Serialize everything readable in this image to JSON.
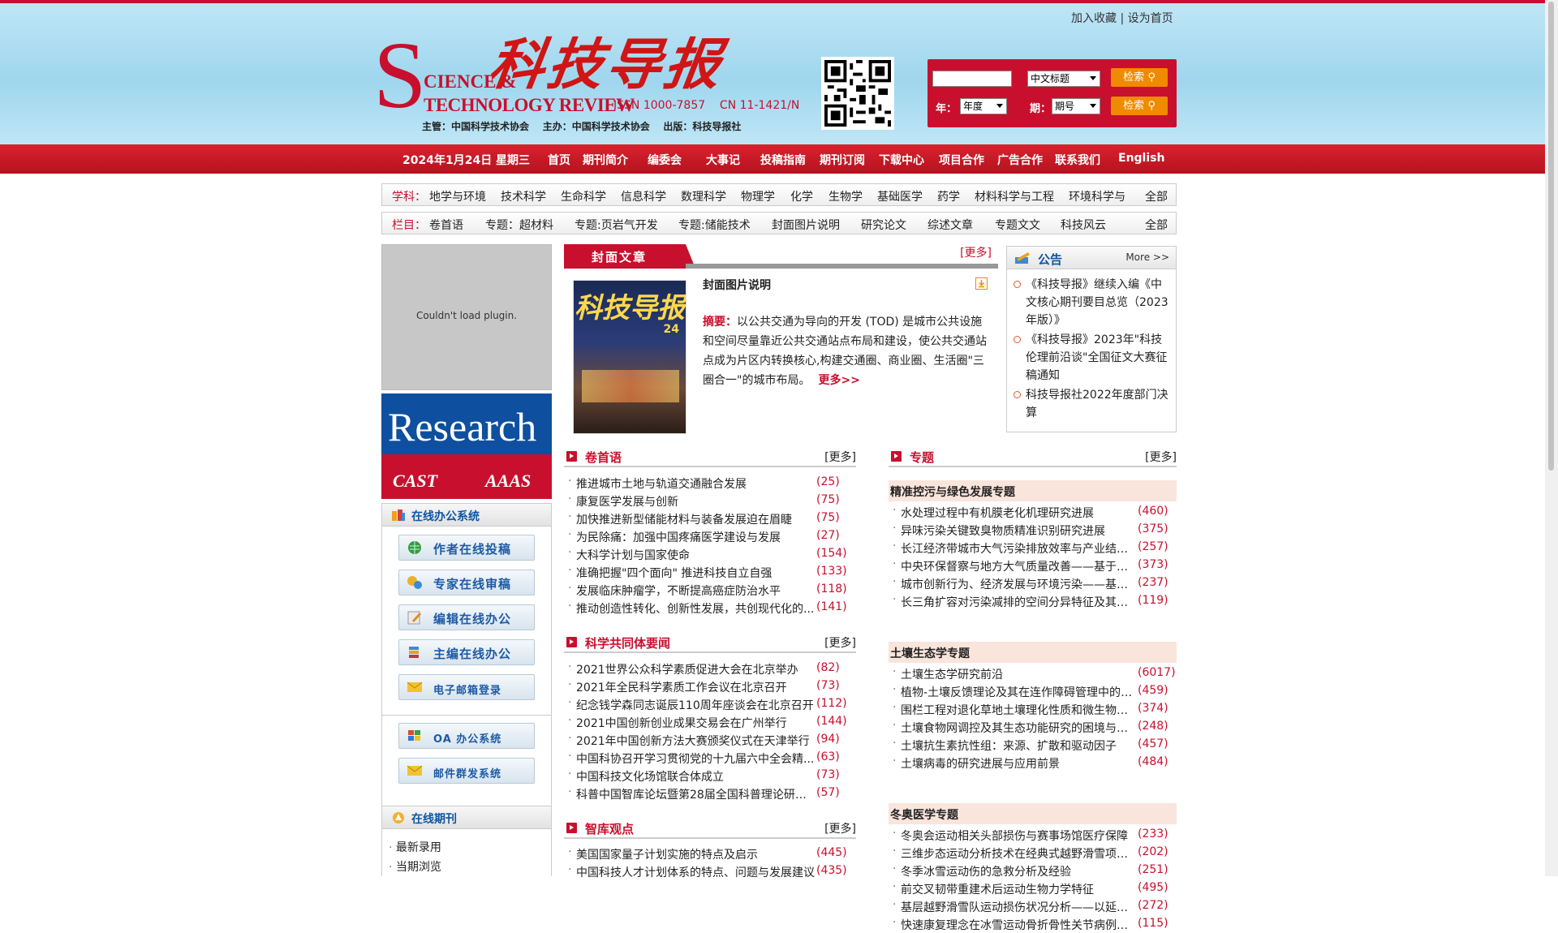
{
  "site": {
    "toplinks": [
      "加入收藏",
      "设为首页"
    ],
    "logo_s": "S",
    "logo_science": "CIENCE &",
    "logo_tech": "TECHNOLOGY REVIEW",
    "logo_cn": "科技导报",
    "issn": "ISSN 1000-7857    CN 11-1421/N",
    "sponsor": "主管：中国科学技术协会    主办：中国科学技术协会    出版：科技导报社"
  },
  "search": {
    "field_select": "中文标题",
    "year_label": "年：",
    "year_select": "年度",
    "issue_label": "期：",
    "issue_select": "期号",
    "btn1": "检索",
    "btn2": "检索"
  },
  "nav": {
    "date": "2024年1月24日 星期三",
    "items": [
      "首页",
      "期刊简介",
      "编委会",
      "大事记",
      "投稿指南",
      "期刊订阅",
      "下载中心",
      "项目合作",
      "广告合作",
      "联系我们",
      "English"
    ]
  },
  "subject": {
    "label": "学科：",
    "items": [
      "地学与环境",
      "技术科学",
      "生命科学",
      "信息科学",
      "数理科学",
      "物理学",
      "化学",
      "生物学",
      "基础医学",
      "药学",
      "材料科学与工程",
      "环境科学与"
    ],
    "all": "全部"
  },
  "column": {
    "label": "栏目：",
    "items": [
      "卷首语",
      "专题：超材料",
      "专题:页岩气开发",
      "专题:储能技术",
      "封面图片说明",
      "研究论文",
      "综述文章",
      "专题文文",
      "科技风云"
    ],
    "all": "全部"
  },
  "plugin": "Couldn't load plugin.",
  "research": {
    "title": "Research",
    "cast": "CAST",
    "aaas": "AAAS"
  },
  "office": {
    "title": "在线办公系统",
    "buttons": [
      "作者在线投稿",
      "专家在线审稿",
      "编辑在线办公",
      "主编在线办公",
      "电子邮箱登录",
      "OA 办公系统",
      "邮件群发系统"
    ]
  },
  "online": {
    "title": "在线期刊",
    "items": [
      "最新录用",
      "当期浏览"
    ]
  },
  "cover": {
    "tab": "封面文章",
    "more": "[更多]",
    "title": "封面图片说明",
    "abstract_label": "摘要：",
    "abstract": "以公共交通为导向的开发 (TOD) 是城市公共设施和空间尽量靠近公共交通站点布局和建设，使公共交通站点成为片区内转换核心,构建交通圈、商业圈、生活圈\"三圈合一\"的城市布局。",
    "more2": "更多>>",
    "img_title": "科技导报",
    "img_num": "24"
  },
  "notice": {
    "title": "公告",
    "more": "More >>",
    "items": [
      "《科技导报》继续入编《中文核心期刊要目总览（2023年版）》",
      "《科技导报》2023年\"科技伦理前沿谈\"全国征文大赛征稿通知",
      "科技导报社2022年度部门决算"
    ]
  },
  "juanshou": {
    "title": "卷首语",
    "more": "[更多]",
    "items": [
      {
        "t": "推进城市土地与轨道交通融合发展",
        "c": "(25)"
      },
      {
        "t": "康复医学发展与创新",
        "c": "(75)"
      },
      {
        "t": "加快推进新型储能材料与装备发展迫在眉睫",
        "c": "(75)"
      },
      {
        "t": "为民除痛：加强中国疼痛医学建设与发展",
        "c": "(27)"
      },
      {
        "t": "大科学计划与国家使命",
        "c": "(154)"
      },
      {
        "t": "准确把握\"四个面向\" 推进科技自立自强",
        "c": "(133)"
      },
      {
        "t": "发展临床肿瘤学，不断提高癌症防治水平",
        "c": "(118)"
      },
      {
        "t": "推动创造性转化、创新性发展，共创现代化的...",
        "c": "(141)"
      }
    ]
  },
  "gongtongti": {
    "title": "科学共同体要闻",
    "more": "[更多]",
    "items": [
      {
        "t": "2021世界公众科学素质促进大会在北京举办",
        "c": "(82)"
      },
      {
        "t": "2021年全民科学素质工作会议在北京召开",
        "c": "(73)"
      },
      {
        "t": "纪念钱学森同志诞辰110周年座谈会在北京召开",
        "c": "(112)"
      },
      {
        "t": "2021中国创新创业成果交易会在广州举行",
        "c": "(144)"
      },
      {
        "t": "2021年中国创新方法大赛颁奖仪式在天津举行",
        "c": "(94)"
      },
      {
        "t": "中国科协召开学习贯彻党的十九届六中全会精...",
        "c": "(63)"
      },
      {
        "t": "中国科技文化场馆联合体成立",
        "c": "(73)"
      },
      {
        "t": "科普中国智库论坛暨第28届全国科普理论研讨...",
        "c": "(57)"
      }
    ]
  },
  "zhiku": {
    "title": "智库观点",
    "more": "[更多]",
    "items": [
      {
        "t": "美国国家量子计划实施的特点及启示",
        "c": "(445)"
      },
      {
        "t": "中国科技人才计划体系的特点、问题与发展建议",
        "c": "(435)"
      }
    ]
  },
  "zhuanti": {
    "title": "专题",
    "more": "[更多]",
    "groups": [
      {
        "name": "精准控污与绿色发展专题",
        "items": [
          {
            "t": "水处理过程中有机膜老化机理研究进展",
            "c": "(460)"
          },
          {
            "t": "异味污染关键致臭物质精准识别研究进展",
            "c": "(375)"
          },
          {
            "t": "长江经济带城市大气污染排放效率与产业结构...",
            "c": "(257)"
          },
          {
            "t": "中央环保督察与地方大气质量改善——基于多...",
            "c": "(373)"
          },
          {
            "t": "城市创新行为、经济发展与环境污染——基于...",
            "c": "(237)"
          },
          {
            "t": "长三角扩容对污染减排的空间分异特征及其机制",
            "c": "(119)"
          }
        ]
      },
      {
        "name": "土壤生态学专题",
        "items": [
          {
            "t": "土壤生态学研究前沿",
            "c": "(6017)"
          },
          {
            "t": "植物-土壤反馈理论及其在连作障碍管理中的应...",
            "c": "(459)"
          },
          {
            "t": "围栏工程对退化草地土壤理化性质和微生物群...",
            "c": "(374)"
          },
          {
            "t": "土壤食物网调控及其生态功能研究的困境与思考",
            "c": "(248)"
          },
          {
            "t": "土壤抗生素抗性组：来源、扩散和驱动因子",
            "c": "(457)"
          },
          {
            "t": "土壤病毒的研究进展与应用前景",
            "c": "(484)"
          }
        ]
      },
      {
        "name": "冬奥医学专题",
        "items": [
          {
            "t": "冬奥会运动相关头部损伤与赛事场馆医疗保障",
            "c": "(233)"
          },
          {
            "t": "三维步态运动分析技术在经典式越野滑雪项目...",
            "c": "(202)"
          },
          {
            "t": "冬季冰雪运动伤的急救分析及经验",
            "c": "(251)"
          },
          {
            "t": "前交叉韧带重建术后运动生物力学特征",
            "c": "(495)"
          },
          {
            "t": "基层越野滑雪队运动损伤状况分析——以延安...",
            "c": "(272)"
          },
          {
            "t": "快速康复理念在冰雪运动骨折骨性关节病例中...",
            "c": "(115)"
          }
        ]
      }
    ]
  }
}
